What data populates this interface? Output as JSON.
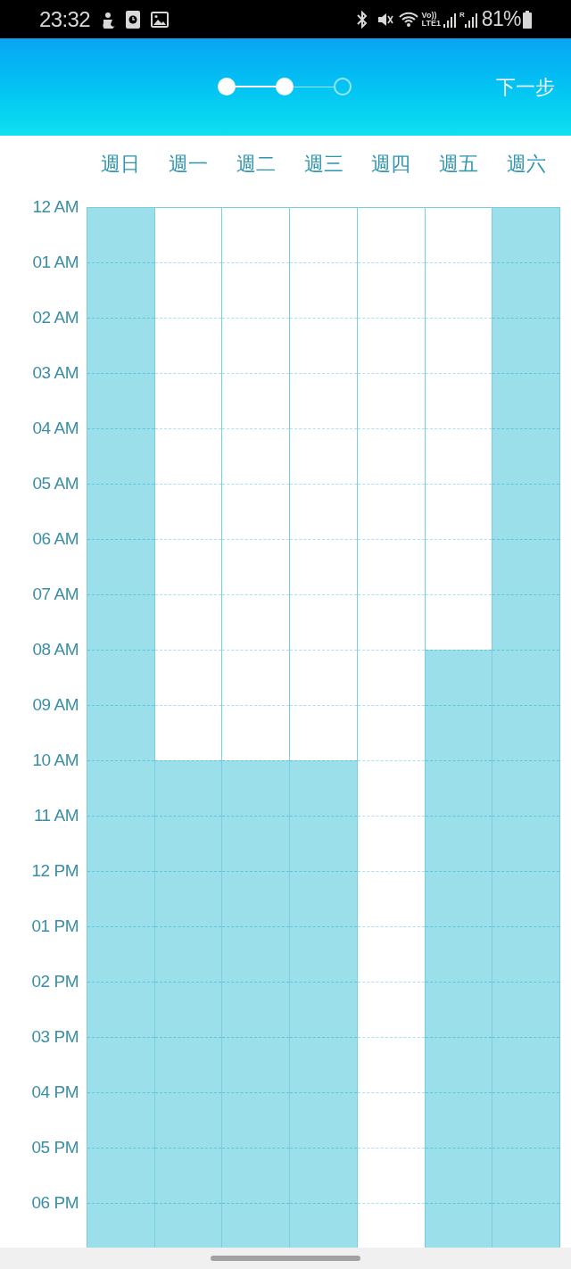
{
  "status_bar": {
    "time": "23:32",
    "volte": [
      "Vo))",
      "LTE1"
    ],
    "roaming": "R",
    "battery": "81%"
  },
  "header": {
    "steps": [
      {
        "done": true
      },
      {
        "done": true
      },
      {
        "done": false
      }
    ],
    "next_button": "下一步"
  },
  "schedule": {
    "days": [
      {
        "label": "週日",
        "hours": [
          true,
          true,
          true,
          true,
          true,
          true,
          true,
          true,
          true,
          true,
          true,
          true,
          true,
          true,
          true,
          true,
          true,
          true,
          true
        ]
      },
      {
        "label": "週一",
        "hours": [
          false,
          false,
          false,
          false,
          false,
          false,
          false,
          false,
          false,
          false,
          true,
          true,
          true,
          true,
          true,
          true,
          true,
          true,
          true
        ]
      },
      {
        "label": "週二",
        "hours": [
          false,
          false,
          false,
          false,
          false,
          false,
          false,
          false,
          false,
          false,
          true,
          true,
          true,
          true,
          true,
          true,
          true,
          true,
          true
        ]
      },
      {
        "label": "週三",
        "hours": [
          false,
          false,
          false,
          false,
          false,
          false,
          false,
          false,
          false,
          false,
          true,
          true,
          true,
          true,
          true,
          true,
          true,
          true,
          true
        ]
      },
      {
        "label": "週四",
        "hours": [
          false,
          false,
          false,
          false,
          false,
          false,
          false,
          false,
          false,
          false,
          false,
          false,
          false,
          false,
          false,
          false,
          false,
          false,
          false
        ]
      },
      {
        "label": "週五",
        "hours": [
          false,
          false,
          false,
          false,
          false,
          false,
          false,
          false,
          true,
          true,
          true,
          true,
          true,
          true,
          true,
          true,
          true,
          true,
          true
        ]
      },
      {
        "label": "週六",
        "hours": [
          true,
          true,
          true,
          true,
          true,
          true,
          true,
          true,
          true,
          true,
          true,
          true,
          true,
          true,
          true,
          true,
          true,
          true,
          true
        ]
      }
    ],
    "times": [
      "12 AM",
      "01 AM",
      "02 AM",
      "03 AM",
      "04 AM",
      "05 AM",
      "06 AM",
      "07 AM",
      "08 AM",
      "09 AM",
      "10 AM",
      "11 AM",
      "12 PM",
      "01 PM",
      "02 PM",
      "03 PM",
      "04 PM",
      "05 PM",
      "06 PM"
    ]
  }
}
